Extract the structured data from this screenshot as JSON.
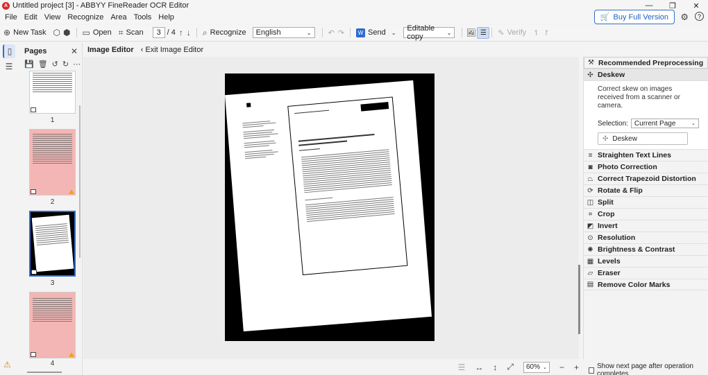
{
  "window": {
    "title": "Untitled project [3] - ABBYY FineReader OCR Editor",
    "minimize_icon": "minimize-icon",
    "maximize_icon": "restore-icon",
    "close_icon": "close-icon"
  },
  "menu": [
    "File",
    "Edit",
    "View",
    "Recognize",
    "Area",
    "Tools",
    "Help"
  ],
  "buy_button": "Buy Full Version",
  "toolbar": {
    "new_task": "New Task",
    "open": "Open",
    "scan": "Scan",
    "page_current": "3",
    "page_total": "/ 4",
    "recognize": "Recognize",
    "language": "English",
    "send": "Send",
    "copy_mode": "Editable copy",
    "verify": "Verify"
  },
  "pages_panel": {
    "title": "Pages",
    "thumbs": [
      {
        "num": "1"
      },
      {
        "num": "2"
      },
      {
        "num": "3"
      },
      {
        "num": "4"
      }
    ]
  },
  "image_editor": {
    "title": "Image Editor",
    "exit": "Exit Image Editor"
  },
  "statusbar": {
    "zoom": "60%"
  },
  "right_panel": {
    "tools": [
      "Recommended Preprocessing",
      "Deskew",
      "Straighten Text Lines",
      "Photo Correction",
      "Correct Trapezoid Distortion",
      "Rotate & Flip",
      "Split",
      "Crop",
      "Invert",
      "Resolution",
      "Brightness & Contrast",
      "Levels",
      "Eraser",
      "Remove Color Marks"
    ],
    "deskew": {
      "description": "Correct skew on images received from a scanner or camera.",
      "selection_label": "Selection:",
      "selection_value": "Current Page",
      "button": "Deskew"
    }
  },
  "bottom_check": "Show next page after operation completes",
  "colors": {
    "accent": "#2c6bd1",
    "logo_red": "#d62c2c",
    "thumb_pink": "#f4b6b4",
    "warning": "#f0a21a"
  }
}
